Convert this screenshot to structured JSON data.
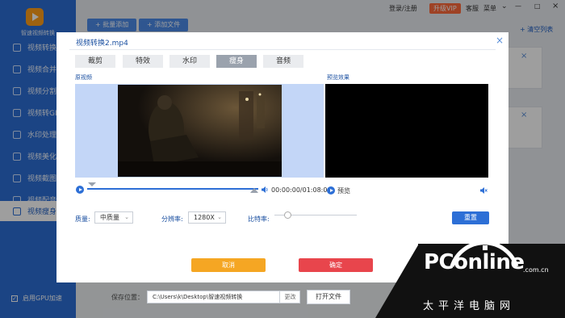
{
  "app": {
    "name": "智速视频转换"
  },
  "sidebar": {
    "items": [
      {
        "label": "视频转换"
      },
      {
        "label": "视频合并"
      },
      {
        "label": "视频分割"
      },
      {
        "label": "视频转GIF"
      },
      {
        "label": "水印处理"
      },
      {
        "label": "视频美化"
      },
      {
        "label": "视频截图"
      },
      {
        "label": "视频配音"
      },
      {
        "label": "视频瘦身"
      }
    ],
    "gpu_label": "启用GPU加速"
  },
  "toolbar": {
    "batch_add": "+ 批量添加",
    "add_file": "+ 添加文件",
    "login": "登录/注册",
    "vip": "升级VIP",
    "help": "客服",
    "menu": "菜单",
    "clear_list": "+ 清空列表"
  },
  "save": {
    "label": "保存位置：",
    "path": "C:\\Users\\k\\Desktop\\智速视频转换",
    "change": "更改",
    "open_folder": "打开文件"
  },
  "dialog": {
    "title": "视频转换2.mp4",
    "tabs": [
      {
        "label": "裁剪"
      },
      {
        "label": "特效"
      },
      {
        "label": "水印"
      },
      {
        "label": "瘦身",
        "active": true
      },
      {
        "label": "音频"
      }
    ],
    "original_label": "原视频",
    "preview_label": "预览效果",
    "time": "00:00:00/01:08:09",
    "preview_btn": "预览",
    "quality_label": "质量:",
    "quality_value": "中质量",
    "resolution_label": "分辨率:",
    "resolution_value": "1280X",
    "bitrate_label": "比特率:",
    "reset": "重置",
    "cancel": "取消",
    "confirm": "确定"
  },
  "watermark": {
    "logo": "PConline",
    "domain": ".com.cn",
    "chinese": "太平洋电脑网"
  }
}
